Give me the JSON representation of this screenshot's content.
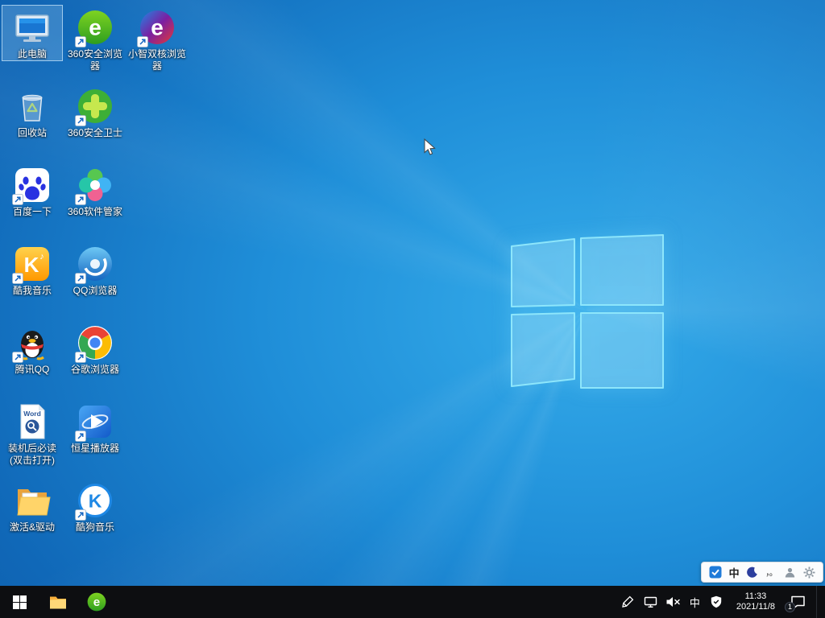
{
  "desktop": {
    "icons": [
      {
        "id": "this-pc",
        "label": "此电脑",
        "col": 0,
        "row": 0,
        "selected": true,
        "shortcut": false
      },
      {
        "id": "recycle-bin",
        "label": "回收站",
        "col": 0,
        "row": 1,
        "selected": false,
        "shortcut": false
      },
      {
        "id": "baidu",
        "label": "百度一下",
        "col": 0,
        "row": 2,
        "selected": false,
        "shortcut": true
      },
      {
        "id": "kuwo-music",
        "label": "酷我音乐",
        "col": 0,
        "row": 3,
        "selected": false,
        "shortcut": true
      },
      {
        "id": "tencent-qq",
        "label": "腾讯QQ",
        "col": 0,
        "row": 4,
        "selected": false,
        "shortcut": true
      },
      {
        "id": "setup-readme",
        "label": "装机后必读(双击打开)",
        "col": 0,
        "row": 5,
        "selected": false,
        "shortcut": false
      },
      {
        "id": "activation-drivers",
        "label": "激活&驱动",
        "col": 0,
        "row": 6,
        "selected": false,
        "shortcut": false
      },
      {
        "id": "browser-360",
        "label": "360安全浏览器",
        "col": 1,
        "row": 0,
        "selected": false,
        "shortcut": true
      },
      {
        "id": "safeguard-360",
        "label": "360安全卫士",
        "col": 1,
        "row": 1,
        "selected": false,
        "shortcut": true
      },
      {
        "id": "software-360",
        "label": "360软件管家",
        "col": 1,
        "row": 2,
        "selected": false,
        "shortcut": true
      },
      {
        "id": "qq-browser",
        "label": "QQ浏览器",
        "col": 1,
        "row": 3,
        "selected": false,
        "shortcut": true
      },
      {
        "id": "chrome",
        "label": "谷歌浏览器",
        "col": 1,
        "row": 4,
        "selected": false,
        "shortcut": true
      },
      {
        "id": "star-player",
        "label": "恒星播放器",
        "col": 1,
        "row": 5,
        "selected": false,
        "shortcut": true
      },
      {
        "id": "kugou-music",
        "label": "酷狗音乐",
        "col": 1,
        "row": 6,
        "selected": false,
        "shortcut": true
      },
      {
        "id": "zhixiao-browser",
        "label": "小智双核浏览器",
        "col": 2,
        "row": 0,
        "selected": false,
        "shortcut": true
      }
    ]
  },
  "taskbar": {
    "buttons": [
      "start",
      "file-explorer",
      "browser-360"
    ],
    "tray": {
      "language": "中",
      "time": "11:33",
      "date": "2021/11/8",
      "notification_badge": "1",
      "icons": [
        "pen-icon",
        "network-icon",
        "volume-muted-icon",
        "security-shield-icon"
      ]
    }
  },
  "ime_bar": {
    "mode": "中",
    "punct": "，。",
    "icons": [
      "ime-logo-icon",
      "moon-icon",
      "person-icon",
      "gear-icon"
    ]
  },
  "colors": {
    "wallpaper_light": "#35acea",
    "wallpaper_base": "#1f8ed8",
    "wallpaper_dark": "#0b539e",
    "logo_stroke": "#8de6fb",
    "taskbar_bg": "#0d0e11",
    "icon_text": "#ffffff",
    "selection": "rgba(150,200,240,0.30)"
  }
}
